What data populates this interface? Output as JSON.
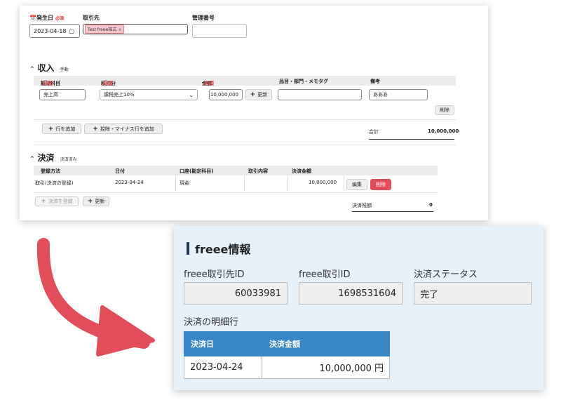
{
  "form": {
    "issue_date_label": "発生日",
    "required": "必須",
    "issue_date": "2023-04-18",
    "partner_label": "取引先",
    "partner_tag": "Test freee株式",
    "partner_tag_remove": "x",
    "manage_no_label": "管理番号",
    "income": {
      "title": "収入",
      "subtitle": "手動",
      "headers": {
        "account": "勘定科目",
        "tax": "税区分",
        "amount": "金額",
        "item": "品目・部門・メモタグ",
        "note": "備考"
      },
      "row": {
        "account": "売上高",
        "tax": "課税売上10%",
        "amount": "10,000,000",
        "update": "更新",
        "item": "",
        "note": "あああ",
        "delete": "削除"
      },
      "add_row": "行を追加",
      "add_deduction": "控除・マイナス行を追加",
      "total_label": "合計",
      "total_value": "10,000,000"
    },
    "settlement": {
      "title": "決済",
      "subtitle": "決済済み",
      "headers": {
        "method": "登録方法",
        "date": "日付",
        "account": "口座(勘定科目)",
        "content": "取引内容",
        "amount": "決済金額"
      },
      "row": {
        "method": "取引(決済の登録)",
        "date": "2023-04-24",
        "account": "現金",
        "content": "",
        "amount": "10,000,000",
        "edit": "編集",
        "delete": "削除"
      },
      "register": "決済を登録",
      "update": "更新",
      "remaining_label": "決済残額",
      "remaining_value": "0"
    }
  },
  "freee_info": {
    "title": "freee情報",
    "partner_id_label": "freee取引先ID",
    "partner_id": "60033981",
    "deal_id_label": "freee取引ID",
    "deal_id": "1698531604",
    "status_label": "決済ステータス",
    "status": "完了",
    "detail_label": "決済の明細行",
    "detail_headers": [
      "決済日",
      "決済金額"
    ],
    "detail_rows": [
      [
        "2023-04-24",
        "10,000,000 円"
      ]
    ]
  },
  "colors": {
    "accent_blue": "#3a87c8",
    "panel_bg": "#e7f1fa",
    "danger": "#e24d5a",
    "arrow": "#e24d5a",
    "tag_bg": "#f5c7cf"
  }
}
